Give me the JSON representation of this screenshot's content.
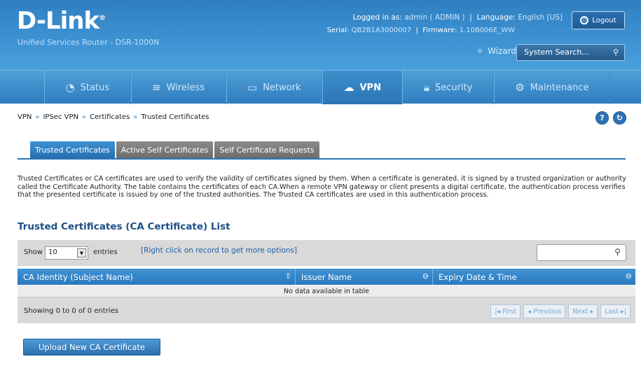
{
  "header": {
    "brand": "D-Link",
    "subtitle": "Unified Services Router - DSR-1000N",
    "logged_in_label": "Logged in as:",
    "logged_in_value": "admin ( ADMIN )",
    "language_label": "Language:",
    "language_value": "English [US]",
    "serial_label": "Serial:",
    "serial_value": "QB2B1A3000007",
    "firmware_label": "Firmware:",
    "firmware_value": "1.10B006E_WW",
    "logout_label": "Logout",
    "wizard_label": "Wizard",
    "search_placeholder": "System Search..."
  },
  "nav": {
    "items": [
      {
        "label": "Status",
        "icon": "gauge-icon"
      },
      {
        "label": "Wireless",
        "icon": "wifi-icon"
      },
      {
        "label": "Network",
        "icon": "monitor-icon"
      },
      {
        "label": "VPN",
        "icon": "cloud-lock-icon"
      },
      {
        "label": "Security",
        "icon": "lock-icon"
      },
      {
        "label": "Maintenance",
        "icon": "gears-icon"
      }
    ],
    "active": "VPN"
  },
  "breadcrumb": [
    "VPN",
    "IPSec VPN",
    "Certificates",
    "Trusted Certificates"
  ],
  "tabs": [
    "Trusted Certificates",
    "Active Self Certificates",
    "Self Certificate Requests"
  ],
  "description": "Trusted Certificates or CA certificates are used to verify the validity of certificates signed by them. When a certificate is generated, it is signed by a trusted organization or authority called the Certificate Authority. The table contains the certificates of each CA.When a remote VPN gateway or client presents a digital certificate, the authentication process verifies that the presented certificate is issued by one of the trusted authorities. The Trusted CA certificates are used in this authentication process.",
  "list_title": "Trusted Certificates (CA Certificate) List",
  "table": {
    "show_label": "Show",
    "entries_value": "10",
    "entries_label": "entries",
    "right_click_hint": "[Right click on record to get more options]",
    "columns": [
      "CA Identity (Subject Name)",
      "Issuer Name",
      "Expiry Date & Time"
    ],
    "no_data": "No data available in table",
    "showing": "Showing 0 to 0 of 0 entries",
    "pager": {
      "first": "First",
      "previous": "Previous",
      "next": "Next",
      "last": "Last"
    }
  },
  "upload_button": "Upload New CA Certificate"
}
